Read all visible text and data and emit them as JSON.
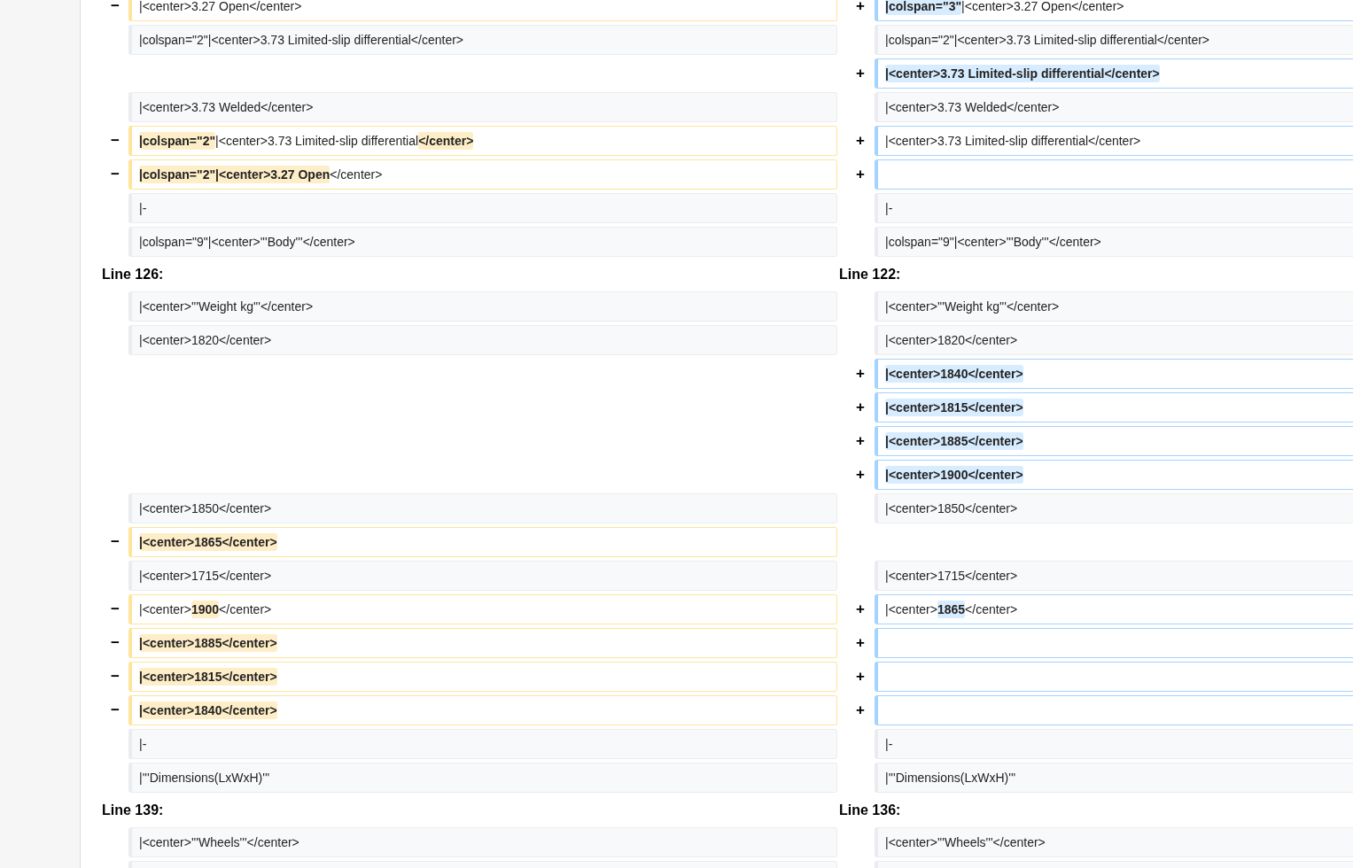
{
  "diff": {
    "rows": [
      {
        "kind": "change",
        "left": {
          "kind": "deleted",
          "marker": "−",
          "segments": [
            {
              "text": "|<center>3.27 Open</center>",
              "changed": false
            }
          ]
        },
        "right": {
          "kind": "added",
          "marker": "+",
          "segments": [
            {
              "text": "|colspan=\"3\"",
              "changed": true
            },
            {
              "text": "|<center>3.27 Open</center>",
              "changed": false
            }
          ]
        }
      },
      {
        "kind": "context",
        "left": {
          "kind": "context",
          "text": "|colspan=\"2\"|<center>3.73 Limited-slip differential</center>"
        },
        "right": {
          "kind": "context",
          "text": "|colspan=\"2\"|<center>3.73 Limited-slip differential</center>"
        }
      },
      {
        "kind": "change",
        "left": {
          "kind": "empty"
        },
        "right": {
          "kind": "added",
          "marker": "+",
          "segments": [
            {
              "text": "|<center>3.73 Limited-slip differential</center>",
              "changed": true
            }
          ]
        }
      },
      {
        "kind": "context",
        "left": {
          "kind": "context",
          "text": "|<center>3.73 Welded</center>"
        },
        "right": {
          "kind": "context",
          "text": "|<center>3.73 Welded</center>"
        }
      },
      {
        "kind": "change",
        "left": {
          "kind": "deleted",
          "marker": "−",
          "segments": [
            {
              "text": "|colspan=\"2\"",
              "changed": true
            },
            {
              "text": "|<center>3.73 Limited-slip differential",
              "changed": false
            },
            {
              "text": "</center>",
              "changed": true
            }
          ]
        },
        "right": {
          "kind": "added",
          "marker": "+",
          "segments": [
            {
              "text": "|<center>3.73 Limited-slip differential</center>",
              "changed": false
            }
          ]
        }
      },
      {
        "kind": "change",
        "left": {
          "kind": "deleted",
          "marker": "−",
          "segments": [
            {
              "text": "|colspan=\"2\"|<center>3.27 Open",
              "changed": true
            },
            {
              "text": "</center>",
              "changed": false
            }
          ]
        },
        "right": {
          "kind": "added",
          "marker": "+"
        }
      },
      {
        "kind": "context",
        "left": {
          "kind": "context",
          "text": "|-"
        },
        "right": {
          "kind": "context",
          "text": "|-"
        }
      },
      {
        "kind": "context",
        "left": {
          "kind": "context",
          "text": "|colspan=\"9\"|<center>'''Body'''</center>"
        },
        "right": {
          "kind": "context",
          "text": "|colspan=\"9\"|<center>'''Body'''</center>"
        }
      },
      {
        "kind": "header",
        "left": "Line 126:",
        "right": "Line 122:"
      },
      {
        "kind": "context",
        "left": {
          "kind": "context",
          "text": "|<center>'''Weight kg'''</center>"
        },
        "right": {
          "kind": "context",
          "text": "|<center>'''Weight kg'''</center>"
        }
      },
      {
        "kind": "context",
        "left": {
          "kind": "context",
          "text": "|<center>1820</center>"
        },
        "right": {
          "kind": "context",
          "text": "|<center>1820</center>"
        }
      },
      {
        "kind": "change",
        "left": {
          "kind": "empty"
        },
        "right": {
          "kind": "added",
          "marker": "+",
          "segments": [
            {
              "text": "|<center>1840</center>",
              "changed": true
            }
          ]
        }
      },
      {
        "kind": "change",
        "left": {
          "kind": "empty"
        },
        "right": {
          "kind": "added",
          "marker": "+",
          "segments": [
            {
              "text": "|<center>1815</center>",
              "changed": true
            }
          ]
        }
      },
      {
        "kind": "change",
        "left": {
          "kind": "empty"
        },
        "right": {
          "kind": "added",
          "marker": "+",
          "segments": [
            {
              "text": "|<center>1885</center>",
              "changed": true
            }
          ]
        }
      },
      {
        "kind": "change",
        "left": {
          "kind": "empty"
        },
        "right": {
          "kind": "added",
          "marker": "+",
          "segments": [
            {
              "text": "|<center>1900</center>",
              "changed": true
            }
          ]
        }
      },
      {
        "kind": "context",
        "left": {
          "kind": "context",
          "text": "|<center>1850</center>"
        },
        "right": {
          "kind": "context",
          "text": "|<center>1850</center>"
        }
      },
      {
        "kind": "change",
        "left": {
          "kind": "deleted",
          "marker": "−",
          "segments": [
            {
              "text": "|<center>1865</center>",
              "changed": true
            }
          ]
        },
        "right": {
          "kind": "empty"
        }
      },
      {
        "kind": "context",
        "left": {
          "kind": "context",
          "text": "|<center>1715</center>"
        },
        "right": {
          "kind": "context",
          "text": "|<center>1715</center>"
        }
      },
      {
        "kind": "change",
        "left": {
          "kind": "deleted",
          "marker": "−",
          "segments": [
            {
              "text": "|<center>",
              "changed": false
            },
            {
              "text": "1900",
              "changed": true
            },
            {
              "text": "</center>",
              "changed": false
            }
          ]
        },
        "right": {
          "kind": "added",
          "marker": "+",
          "segments": [
            {
              "text": "|<center>",
              "changed": false
            },
            {
              "text": "1865",
              "changed": true
            },
            {
              "text": "</center>",
              "changed": false
            }
          ]
        }
      },
      {
        "kind": "change",
        "left": {
          "kind": "deleted",
          "marker": "−",
          "segments": [
            {
              "text": "|<center>1885</center>",
              "changed": true
            }
          ]
        },
        "right": {
          "kind": "added",
          "marker": "+"
        }
      },
      {
        "kind": "change",
        "left": {
          "kind": "deleted",
          "marker": "−",
          "segments": [
            {
              "text": "|<center>1815</center>",
              "changed": true
            }
          ]
        },
        "right": {
          "kind": "added",
          "marker": "+"
        }
      },
      {
        "kind": "change",
        "left": {
          "kind": "deleted",
          "marker": "−",
          "segments": [
            {
              "text": "|<center>1840</center>",
              "changed": true
            }
          ]
        },
        "right": {
          "kind": "added",
          "marker": "+"
        }
      },
      {
        "kind": "context",
        "left": {
          "kind": "context",
          "text": "|-"
        },
        "right": {
          "kind": "context",
          "text": "|-"
        }
      },
      {
        "kind": "context",
        "left": {
          "kind": "context",
          "text": "|'''Dimensions(LxWxH)'''"
        },
        "right": {
          "kind": "context",
          "text": "|'''Dimensions(LxWxH)'''"
        }
      },
      {
        "kind": "header",
        "left": "Line 139:",
        "right": "Line 136:"
      },
      {
        "kind": "context",
        "left": {
          "kind": "context",
          "text": "|<center>'''Wheels'''</center>"
        },
        "right": {
          "kind": "context",
          "text": "|<center>'''Wheels'''</center>"
        }
      },
      {
        "kind": "context",
        "left": {
          "kind": "context"
        },
        "right": {
          "kind": "context"
        }
      }
    ]
  }
}
